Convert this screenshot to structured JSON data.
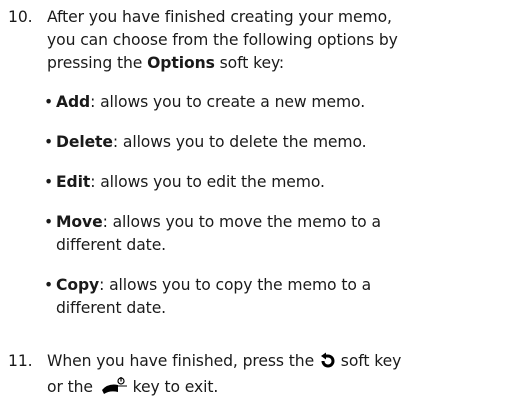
{
  "step10": {
    "number": "10.",
    "line1": "After you have finished creating your memo,",
    "line2": "you can choose from the following options by",
    "line3_pre": "pressing the ",
    "line3_bold": "Options",
    "line3_post": " soft key:"
  },
  "options": [
    {
      "term": "Add",
      "desc": ": allows you to create a new memo.",
      "desc2": ""
    },
    {
      "term": "Delete",
      "desc": ": allows you to delete the memo.",
      "desc2": ""
    },
    {
      "term": "Edit",
      "desc": ": allows you to edit the memo.",
      "desc2": ""
    },
    {
      "term": "Move",
      "desc": ": allows you to move the memo to a",
      "desc2": "different date."
    },
    {
      "term": "Copy",
      "desc": ": allows you to copy the memo to a",
      "desc2": "different date."
    }
  ],
  "bullet_char": "•",
  "step11": {
    "number": "11.",
    "line1_pre": "When you have finished, press the ",
    "line1_post": " soft key",
    "line2_pre": "or the ",
    "line2_post": " key to exit."
  },
  "icons": {
    "back_icon": "back-arrow-icon",
    "end_key_icon": "end-power-key-icon"
  }
}
